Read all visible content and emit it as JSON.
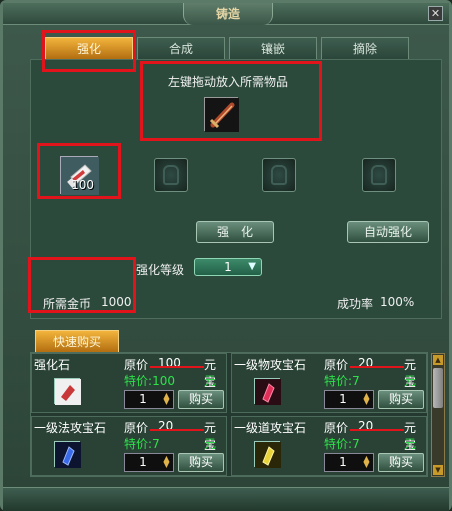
{
  "window": {
    "title": "铸造",
    "close_glyph": "✕"
  },
  "tabs": [
    {
      "label": "强化",
      "active": true
    },
    {
      "label": "合成",
      "active": false
    },
    {
      "label": "镶嵌",
      "active": false
    },
    {
      "label": "摘除",
      "active": false
    }
  ],
  "enhance": {
    "drop_hint": "左键拖动放入所需物品",
    "target_item_icon": "sword-icon",
    "material_item_icon": "scroll-icon",
    "material_qty": "100",
    "enhance_button": "强　化",
    "auto_enhance_button": "自动强化",
    "level_label": "强化等级",
    "level_value": "1",
    "gold_label": "所需金币",
    "gold_value": "1000",
    "success_label": "成功率",
    "success_value": "100%"
  },
  "quick_buy": {
    "tab_label": "快速购买",
    "price_label": "原价",
    "sale_label": "特价",
    "currency": "元宝",
    "buy_label": "购买",
    "items": [
      {
        "name": "强化石",
        "price": "100",
        "sale": "100",
        "qty": "1",
        "icon": "enhance-stone-icon",
        "color": "#8b3a3a"
      },
      {
        "name": "一级物攻宝石",
        "price": "20",
        "sale": "7",
        "qty": "1",
        "icon": "red-gem-icon",
        "color": "#e0305a"
      },
      {
        "name": "一级法攻宝石",
        "price": "20",
        "sale": "7",
        "qty": "1",
        "icon": "blue-gem-icon",
        "color": "#3a6ae8"
      },
      {
        "name": "一级道攻宝石",
        "price": "20",
        "sale": "7",
        "qty": "1",
        "icon": "yellow-gem-icon",
        "color": "#e8d43a"
      }
    ]
  }
}
